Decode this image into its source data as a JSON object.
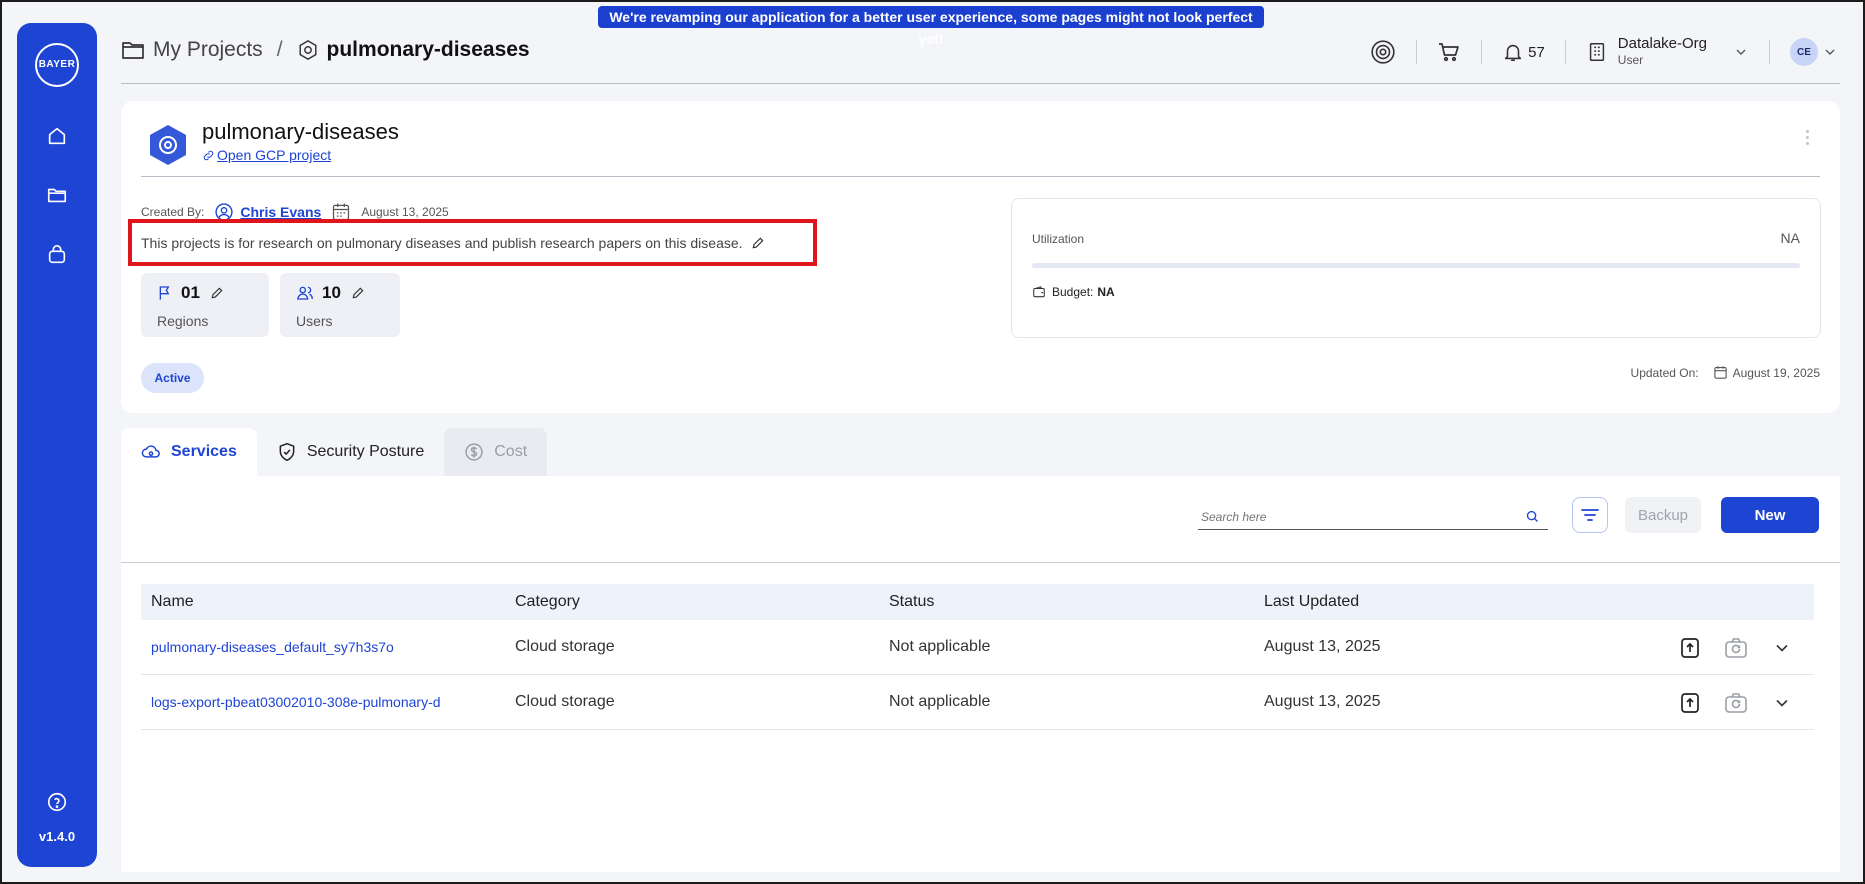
{
  "banner": "We're revamping our application for a better user experience, some pages might not look perfect yet!",
  "sidebar": {
    "logo_text": "BAYER",
    "version": "v1.4.0",
    "items": [
      {
        "name": "home-icon"
      },
      {
        "name": "folder-icon"
      },
      {
        "name": "bag-icon"
      },
      {
        "name": "help-icon"
      }
    ]
  },
  "breadcrumb": {
    "root": "My Projects",
    "separator": "/",
    "current": "pulmonary-diseases"
  },
  "header": {
    "notification_count": "57",
    "org_name": "Datalake-Org",
    "org_role": "User",
    "avatar_initials": "CE"
  },
  "project": {
    "title": "pulmonary-diseases",
    "gcp_link": "Open GCP project",
    "created_by_label": "Created By:",
    "creator": "Chris Evans",
    "created_date": "August 13, 2025",
    "description": "This projects is for research on pulmonary diseases and publish research papers on this disease.",
    "regions": {
      "count": "01",
      "label": "Regions"
    },
    "users": {
      "count": "10",
      "label": "Users"
    },
    "status": "Active",
    "utilization": {
      "label": "Utilization",
      "value": "NA",
      "fill": 0
    },
    "budget_label": "Budget:",
    "budget_value": "NA",
    "updated_label": "Updated On:",
    "updated_date": "August 19, 2025"
  },
  "tabs": [
    {
      "label": "Services",
      "state": "active"
    },
    {
      "label": "Security Posture",
      "state": "normal"
    },
    {
      "label": "Cost",
      "state": "disabled"
    }
  ],
  "services": {
    "search_placeholder": "Search here",
    "backup_label": "Backup",
    "new_label": "New",
    "columns": [
      "Name",
      "Category",
      "Status",
      "Last Updated"
    ],
    "rows": [
      {
        "name": "pulmonary-diseases_default_sy7h3s7o",
        "category": "Cloud storage",
        "status": "Not applicable",
        "updated": "August 13, 2025"
      },
      {
        "name": "logs-export-pbeat03002010-308e-pulmonary-d",
        "category": "Cloud storage",
        "status": "Not applicable",
        "updated": "August 13, 2025"
      }
    ]
  },
  "colors": {
    "accent": "#1e44d4",
    "highlight_box": "#e0141b"
  }
}
